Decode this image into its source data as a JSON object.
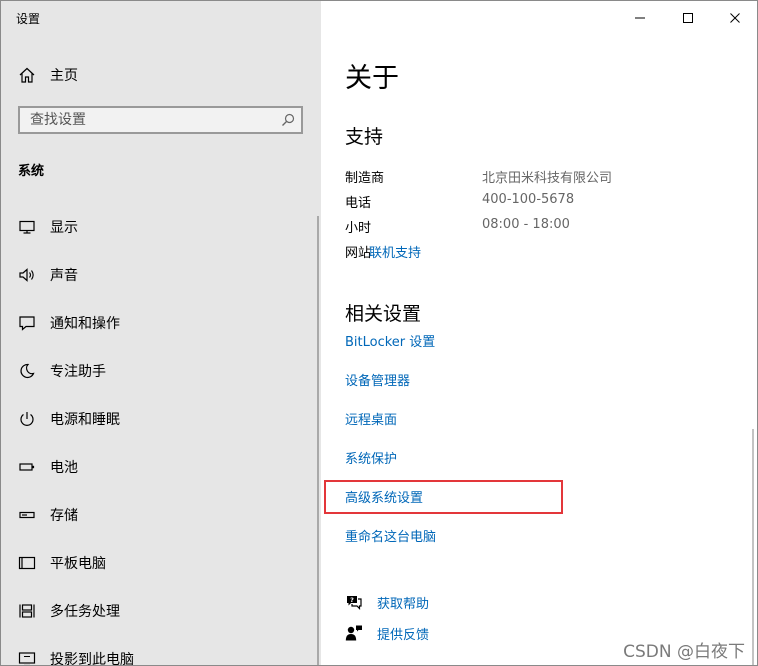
{
  "window": {
    "title": "设置"
  },
  "sidebar": {
    "home_label": "主页",
    "search_placeholder": "查找设置",
    "section_label": "系统",
    "items": [
      {
        "label": "显示",
        "icon": "monitor-icon"
      },
      {
        "label": "声音",
        "icon": "speaker-icon"
      },
      {
        "label": "通知和操作",
        "icon": "notification-icon"
      },
      {
        "label": "专注助手",
        "icon": "moon-icon"
      },
      {
        "label": "电源和睡眠",
        "icon": "power-icon"
      },
      {
        "label": "电池",
        "icon": "battery-icon"
      },
      {
        "label": "存储",
        "icon": "storage-icon"
      },
      {
        "label": "平板电脑",
        "icon": "tablet-icon"
      },
      {
        "label": "多任务处理",
        "icon": "multitasking-icon"
      },
      {
        "label": "投影到此电脑",
        "icon": "projection-icon"
      }
    ]
  },
  "main": {
    "title": "关于",
    "support": {
      "heading": "支持",
      "rows": [
        {
          "key": "制造商",
          "value": "北京田米科技有限公司"
        },
        {
          "key": "电话",
          "value": "400-100-5678"
        },
        {
          "key": "小时",
          "value": "08:00 - 18:00"
        },
        {
          "key": "网站",
          "value": "联机支持"
        }
      ]
    },
    "related": {
      "heading": "相关设置",
      "links": [
        "BitLocker 设置",
        "设备管理器",
        "远程桌面",
        "系统保护",
        "高级系统设置",
        "重命名这台电脑"
      ]
    },
    "help": [
      {
        "label": "获取帮助",
        "icon": "help-chat-icon"
      },
      {
        "label": "提供反馈",
        "icon": "feedback-icon"
      }
    ]
  },
  "watermark": "CSDN @白夜下",
  "colors": {
    "sidebar_bg": "#e6e6e6",
    "link": "#0067b8",
    "highlight_box": "#e3363a"
  }
}
